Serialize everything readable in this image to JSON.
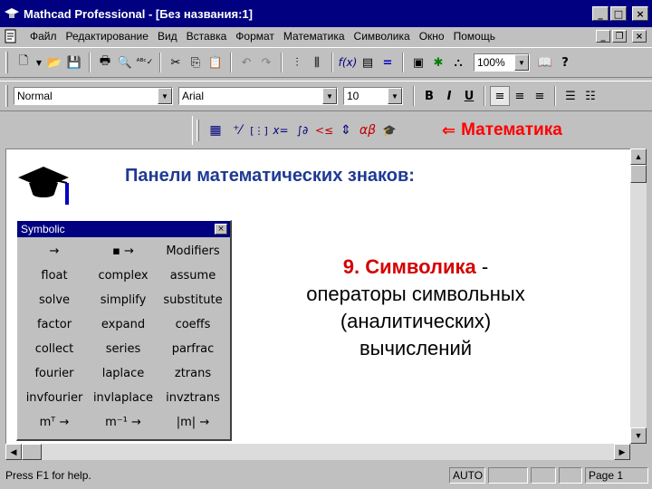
{
  "window": {
    "title": "Mathcad Professional - [Без названия:1]",
    "min_glyph": "_",
    "max_glyph": "□",
    "close_glyph": "×",
    "restore_glyph": "❐"
  },
  "menu": {
    "items": [
      "Файл",
      "Редактирование",
      "Вид",
      "Вставка",
      "Формат",
      "Математика",
      "Символика",
      "Окно",
      "Помощь"
    ]
  },
  "toolbar": {
    "zoom": "100%"
  },
  "format_bar": {
    "style": "Normal",
    "font": "Arial",
    "size": "10",
    "bold": "B",
    "italic": "I",
    "underline": "U"
  },
  "math_bar": {
    "caption": "Математика",
    "buttons": [
      "▦",
      "⁺⁄",
      "[⋮]",
      "x=",
      "∫∂",
      "<≤",
      "⇕",
      "αβ",
      "🎓"
    ]
  },
  "document": {
    "heading": "Панели математических знаков:",
    "desc_title": "9. Символика",
    "desc_dash": " -",
    "desc_lines": [
      "операторы символьных",
      "(аналитических)",
      "вычислений"
    ]
  },
  "palette": {
    "title": "Symbolic",
    "cells": [
      "→",
      "▪ →",
      "Modifiers",
      "float",
      "complex",
      "assume",
      "solve",
      "simplify",
      "substitute",
      "factor",
      "expand",
      "coeffs",
      "collect",
      "series",
      "parfrac",
      "fourier",
      "laplace",
      "ztrans",
      "invfourier",
      "invlaplace",
      "invztrans",
      "mᵀ →",
      "m⁻¹ →",
      "|m| →"
    ]
  },
  "status": {
    "help": "Press F1 for help.",
    "mode": "AUTO",
    "page": "Page 1"
  }
}
